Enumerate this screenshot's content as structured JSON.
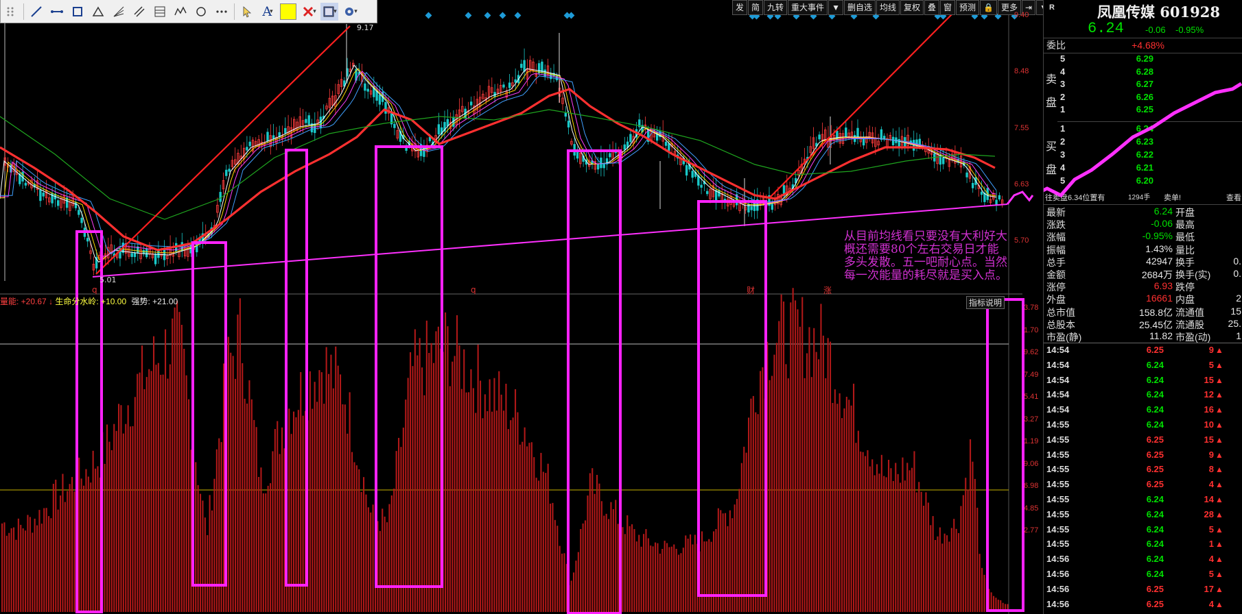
{
  "toolbar": {
    "tools": [
      "line-icon",
      "segment-icon",
      "rectangle-icon",
      "triangle-icon",
      "fan-icon",
      "parallel-icon",
      "fibonacci-icon",
      "wave-icon",
      "circle-icon",
      "more-icon",
      "pointer-icon",
      "text-icon",
      "color-swatch",
      "delete-icon",
      "layout-icon",
      "settings-icon"
    ],
    "text_tool_label": "A"
  },
  "menu": [
    "发",
    "简",
    "九转",
    "重大事件",
    "▼",
    "删自选",
    "均线",
    "复权",
    "叠",
    "窗",
    "预测",
    "🔒",
    "更多",
    "⇥",
    "▼"
  ],
  "price_axis": [
    "9.40",
    "8.48",
    "7.55",
    "6.63",
    "5.70"
  ],
  "chart_labels": {
    "high_label": "9.17",
    "low_label": "5.01",
    "tag_q1": "q",
    "tag_q2": "q",
    "tag_cai": "财",
    "tag_zhang": "涨"
  },
  "indicator": {
    "name": "量能: +20.67",
    "arrow": "↓",
    "life": "生命分水岭: +10.00",
    "strength": "强势: +21.00",
    "button": "指标说明",
    "axis": [
      "3.78",
      "1.70",
      "9.62",
      "7.49",
      "5.41",
      "3.27",
      "1.19",
      "9.06",
      "6.98",
      "4.85",
      "2.77"
    ]
  },
  "annotation": "从目前均线看只要没有大利好大概还需要80个左右交易日才能多头发散。五一吧耐心点。当然每一次能量的耗尽就是买入点。",
  "quote": {
    "r": "R",
    "name": "凤凰传媒 601928",
    "price": "6.24",
    "change": "-0.06",
    "pct": "-0.95%",
    "wei_bi_label": "委比",
    "wei_bi": "+4.68%",
    "sell_label": "卖盘",
    "buy_label": "买盘",
    "asks": [
      {
        "lvl": "5",
        "price": "6.29"
      },
      {
        "lvl": "4",
        "price": "6.28"
      },
      {
        "lvl": "3",
        "price": "6.27"
      },
      {
        "lvl": "2",
        "price": "6.26"
      },
      {
        "lvl": "1",
        "price": "6.25"
      }
    ],
    "bids": [
      {
        "lvl": "1",
        "price": "6.24"
      },
      {
        "lvl": "2",
        "price": "6.23"
      },
      {
        "lvl": "3",
        "price": "6.22"
      },
      {
        "lvl": "4",
        "price": "6.21"
      },
      {
        "lvl": "5",
        "price": "6.20"
      }
    ],
    "notice": "往卖盘6.34位置有",
    "notice_vol": "1294手",
    "notice_tail": "卖单!",
    "notice_btn": "查看",
    "stats": [
      {
        "l": "最新",
        "v": "6.24",
        "vc": "green",
        "l2": "开盘",
        "v2": ""
      },
      {
        "l": "涨跌",
        "v": "-0.06",
        "vc": "green",
        "l2": "最高",
        "v2": ""
      },
      {
        "l": "涨幅",
        "v": "-0.95%",
        "vc": "green",
        "l2": "最低",
        "v2": ""
      },
      {
        "l": "振幅",
        "v": "1.43%",
        "vc": "white",
        "l2": "量比",
        "v2": ""
      },
      {
        "l": "总手",
        "v": "42947",
        "vc": "white",
        "l2": "换手",
        "v2": "0."
      },
      {
        "l": "金额",
        "v": "2684万",
        "vc": "white",
        "l2": "换手(实)",
        "v2": "0."
      },
      {
        "l": "涨停",
        "v": "6.93",
        "vc": "red",
        "l2": "跌停",
        "v2": ""
      },
      {
        "l": "外盘",
        "v": "16661",
        "vc": "red",
        "l2": "内盘",
        "v2": "2"
      },
      {
        "l": "总市值",
        "v": "158.8亿",
        "vc": "white",
        "l2": "流通值",
        "v2": "15"
      },
      {
        "l": "总股本",
        "v": "25.45亿",
        "vc": "white",
        "l2": "流通股",
        "v2": "25."
      },
      {
        "l": "市盈(静)",
        "v": "11.82",
        "vc": "white",
        "l2": "市盈(动)",
        "v2": "1"
      }
    ],
    "ticks": [
      {
        "t": "14:54",
        "p": "6.25",
        "pc": "red",
        "v": "9"
      },
      {
        "t": "14:54",
        "p": "6.24",
        "pc": "green",
        "v": "5"
      },
      {
        "t": "14:54",
        "p": "6.24",
        "pc": "green",
        "v": "15"
      },
      {
        "t": "14:54",
        "p": "6.24",
        "pc": "green",
        "v": "12"
      },
      {
        "t": "14:54",
        "p": "6.24",
        "pc": "green",
        "v": "16"
      },
      {
        "t": "14:55",
        "p": "6.24",
        "pc": "green",
        "v": "10"
      },
      {
        "t": "14:55",
        "p": "6.25",
        "pc": "red",
        "v": "15"
      },
      {
        "t": "14:55",
        "p": "6.25",
        "pc": "red",
        "v": "9"
      },
      {
        "t": "14:55",
        "p": "6.25",
        "pc": "red",
        "v": "8"
      },
      {
        "t": "14:55",
        "p": "6.25",
        "pc": "red",
        "v": "4"
      },
      {
        "t": "14:55",
        "p": "6.24",
        "pc": "green",
        "v": "14"
      },
      {
        "t": "14:55",
        "p": "6.24",
        "pc": "green",
        "v": "28"
      },
      {
        "t": "14:55",
        "p": "6.24",
        "pc": "green",
        "v": "5"
      },
      {
        "t": "14:55",
        "p": "6.24",
        "pc": "green",
        "v": "1"
      },
      {
        "t": "14:56",
        "p": "6.24",
        "pc": "green",
        "v": "4"
      },
      {
        "t": "14:56",
        "p": "6.24",
        "pc": "green",
        "v": "5"
      },
      {
        "t": "14:56",
        "p": "6.25",
        "pc": "red",
        "v": "17"
      },
      {
        "t": "14:56",
        "p": "6.25",
        "pc": "red",
        "v": "4"
      }
    ]
  },
  "colors": {
    "ma_red": "#ff3030",
    "ma_green": "#1fa61f",
    "box": "#ff22ff",
    "bars": "#b01818"
  }
}
